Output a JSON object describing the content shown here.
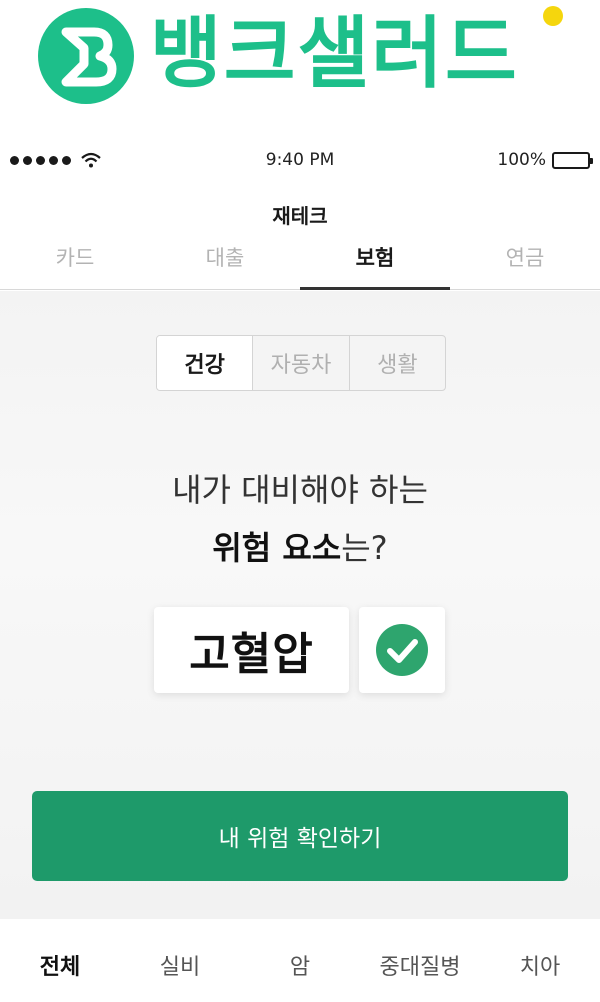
{
  "brand": {
    "name": "뱅크샐러드",
    "logo_letter": "B",
    "color": "#1dbf8a",
    "dot_color": "#f5d60d"
  },
  "status_bar": {
    "time": "9:40 PM",
    "battery": "100%"
  },
  "screen": {
    "title": "재테크"
  },
  "tabs": [
    {
      "label": "카드",
      "active": false
    },
    {
      "label": "대출",
      "active": false
    },
    {
      "label": "보험",
      "active": true
    },
    {
      "label": "연금",
      "active": false
    }
  ],
  "segments": [
    {
      "label": "건강",
      "active": true
    },
    {
      "label": "자동차",
      "active": false
    },
    {
      "label": "생활",
      "active": false
    }
  ],
  "question": {
    "line1": "내가 대비해야 하는",
    "line2_strong": "위험 요소",
    "line2_rest": "는?"
  },
  "risk": {
    "label": "고혈압",
    "checked": true,
    "check_color": "#2ea56e"
  },
  "cta": {
    "label": "내 위험 확인하기",
    "color": "#1e9a6a"
  },
  "bottom_tabs": [
    {
      "label": "전체",
      "active": true
    },
    {
      "label": "실비",
      "active": false
    },
    {
      "label": "암",
      "active": false
    },
    {
      "label": "중대질병",
      "active": false
    },
    {
      "label": "치아",
      "active": false
    }
  ]
}
